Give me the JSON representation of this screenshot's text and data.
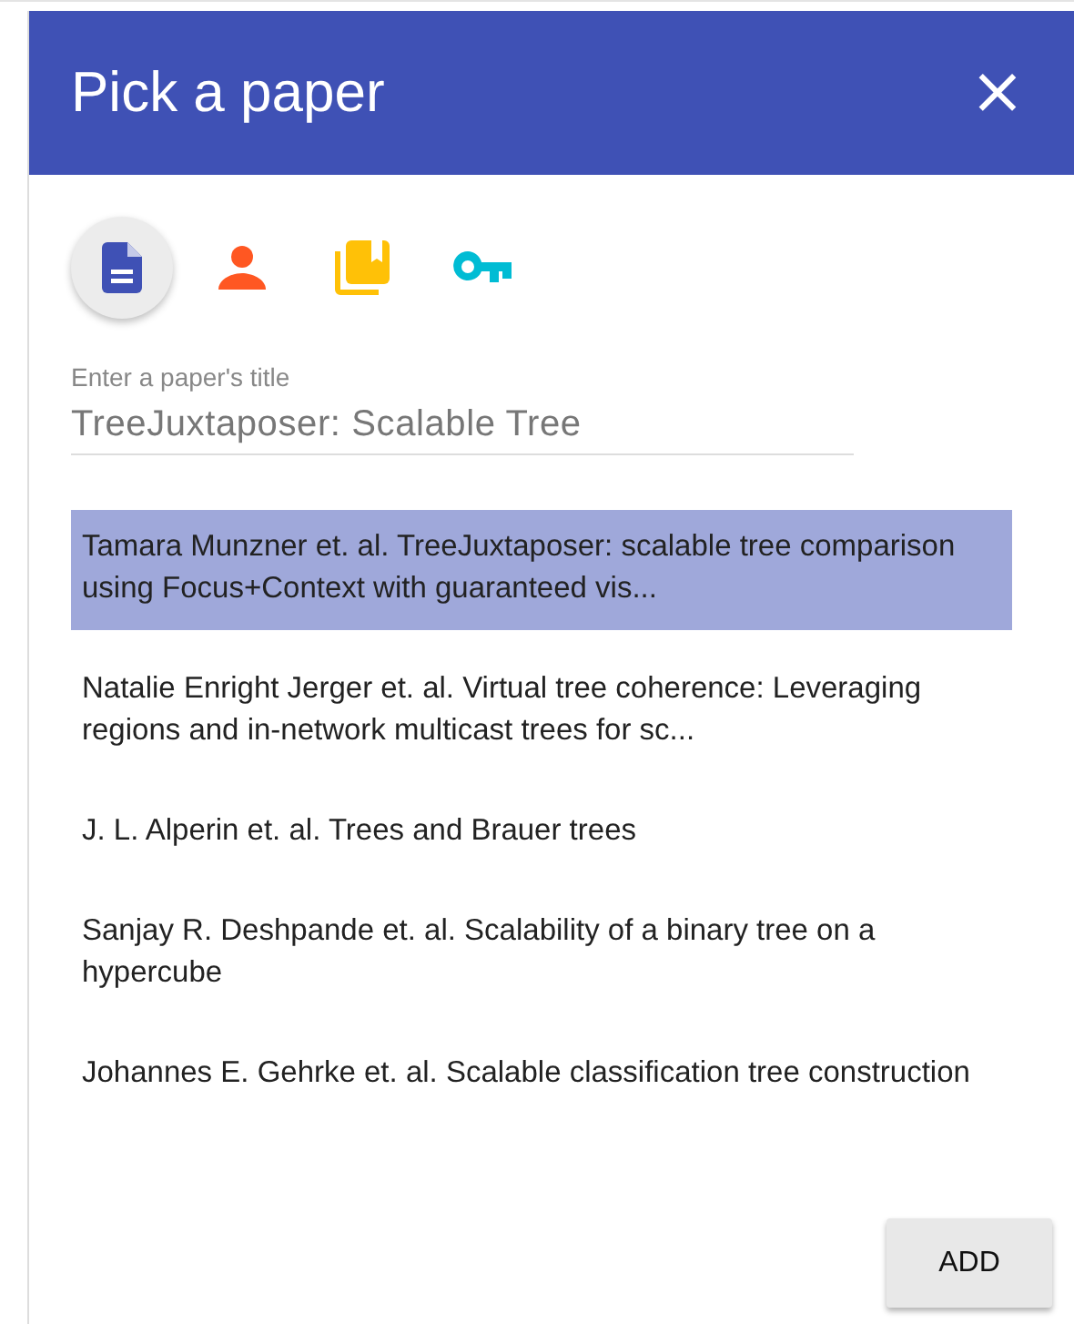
{
  "dialog": {
    "title": "Pick a paper",
    "close": "×"
  },
  "tabs": [
    {
      "kind": "document",
      "selected": true
    },
    {
      "kind": "person",
      "selected": false
    },
    {
      "kind": "library",
      "selected": false
    },
    {
      "kind": "key",
      "selected": false
    }
  ],
  "field": {
    "label": "Enter a paper's title",
    "value": "TreeJuxtaposer: Scalable Tree"
  },
  "results": [
    {
      "text": "Tamara Munzner et. al. TreeJuxtaposer: scalable tree comparison using Focus+Context with guaranteed vis...",
      "selected": true
    },
    {
      "text": "Natalie Enright Jerger et. al. Virtual tree coherence: Leveraging regions and in-network multicast trees for sc...",
      "selected": false
    },
    {
      "text": "J. L. Alperin et. al. Trees and Brauer trees",
      "selected": false
    },
    {
      "text": "Sanjay R. Deshpande et. al. Scalability of a binary tree on a hypercube",
      "selected": false
    },
    {
      "text": "Johannes E. Gehrke et. al. Scalable classification tree construction",
      "selected": false
    }
  ],
  "buttons": [
    {
      "label": "ADD"
    }
  ]
}
